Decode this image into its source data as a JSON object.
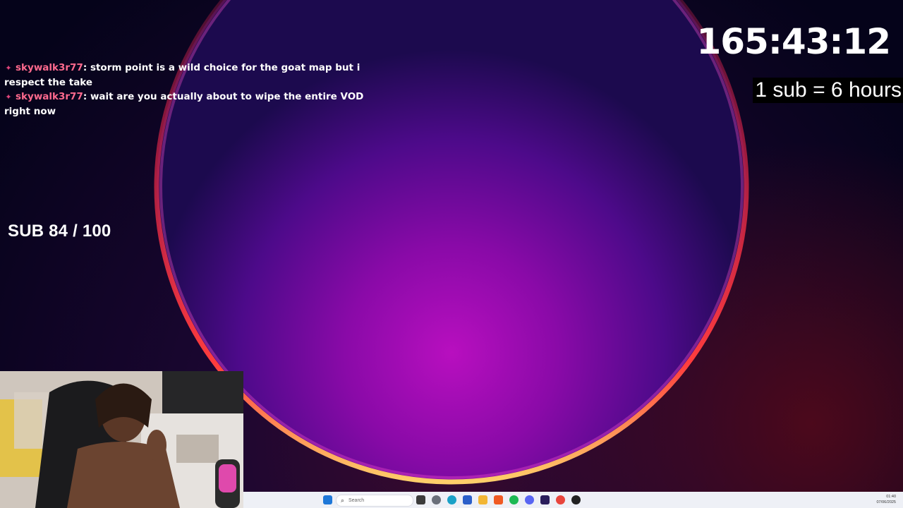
{
  "chat": {
    "messages": [
      {
        "user": "skywalk3r77",
        "text": ": storm point is a wild choice for the goat map but i respect the take"
      },
      {
        "user": "skywalk3r77",
        "text": ": wait are you actually about to wipe the entire VOD right now"
      }
    ],
    "badge_icon": "streamer-badge-icon"
  },
  "subathon": {
    "goal_text": "SUB 84 / 100",
    "timer": "165:43:12",
    "rate_text": "1 sub = 6 hours"
  },
  "taskbar": {
    "search_placeholder": "Search",
    "clock_time": "01:40",
    "clock_date": "07/06/2025",
    "apps": [
      {
        "name": "start-icon",
        "color": "#1f78d8"
      },
      {
        "name": "task-view-icon",
        "color": "#3b3b3b"
      },
      {
        "name": "settings-icon",
        "color": "#6a6f7a"
      },
      {
        "name": "edge-icon",
        "color": "#1aa1c7"
      },
      {
        "name": "store-icon",
        "color": "#2b5fc9"
      },
      {
        "name": "file-explorer-icon",
        "color": "#f2b635"
      },
      {
        "name": "brave-icon",
        "color": "#f05a23"
      },
      {
        "name": "spotify-icon",
        "color": "#1db954"
      },
      {
        "name": "discord-icon",
        "color": "#5865f2"
      },
      {
        "name": "premiere-icon",
        "color": "#2a1d5c"
      },
      {
        "name": "chrome-icon",
        "color": "#e8453c"
      },
      {
        "name": "obs-icon",
        "color": "#222222"
      }
    ]
  }
}
